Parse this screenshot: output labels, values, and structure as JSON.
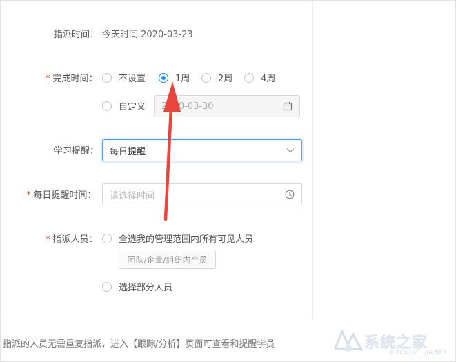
{
  "assign_time": {
    "label": "指派时间：",
    "value": "今天时间 2020-03-23"
  },
  "finish_time": {
    "required_mark": "*",
    "label": "完成时间：",
    "options": [
      "不设置",
      "1周",
      "2周",
      "4周"
    ],
    "selected": "1周",
    "custom_label": "自定义",
    "custom_date": "2020-03-30"
  },
  "study_reminder": {
    "label": "学习提醒：",
    "value": "每日提醒"
  },
  "daily_reminder_time": {
    "required_mark": "*",
    "label": "每日提醒时间：",
    "placeholder": "请选择时间"
  },
  "assignees": {
    "required_mark": "*",
    "label": "指派人员：",
    "option_all": "全选我的管理范围内所有可见人员",
    "tag": "团队/企业/组织内全员",
    "option_partial": "选择部分人员"
  },
  "footer_note": "指派的人员无需重复指派，进入【跟踪/分析】页面可查看和提醒学员",
  "watermark": {
    "text": "系统之家",
    "url": "XITONGZHIJIA.NET"
  },
  "colors": {
    "accent": "#1890ff",
    "required": "#e4393c",
    "annotation_arrow": "#e8453c"
  },
  "icons": {
    "calendar": "calendar-icon",
    "chevron": "chevron-down-icon",
    "clock": "clock-icon"
  }
}
